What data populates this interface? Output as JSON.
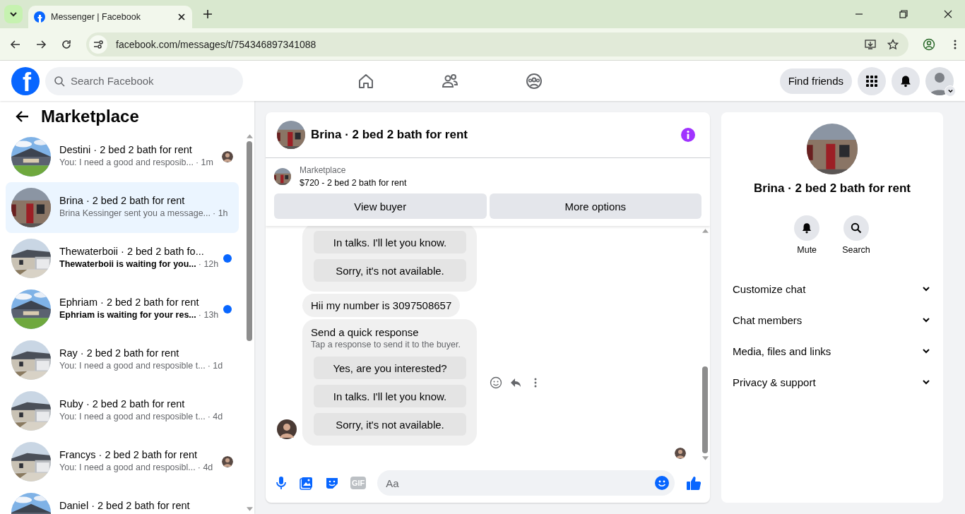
{
  "browser": {
    "tab_title": "Messenger | Facebook",
    "url": "facebook.com/messages/t/754346897341088"
  },
  "topbar": {
    "logo": "f",
    "search_placeholder": "Search Facebook",
    "find_friends": "Find friends"
  },
  "sidebar": {
    "title": "Marketplace",
    "conversations": [
      {
        "name": "Destini · 2 bed 2 bath for rent",
        "preview": "You: I need a good and resposib...",
        "time": "· 1m",
        "unread": false,
        "seen": true,
        "selected": false
      },
      {
        "name": "Brina · 2 bed 2 bath for rent",
        "preview": "Brina Kessinger sent you a message...",
        "time": "· 1h",
        "unread": false,
        "seen": false,
        "selected": true
      },
      {
        "name": "Thewaterboii · 2 bed 2 bath fo...",
        "preview": "Thewaterboii is waiting for you...",
        "time": "· 12h",
        "unread": true,
        "seen": false,
        "selected": false
      },
      {
        "name": "Ephriam · 2 bed 2 bath for rent",
        "preview": "Ephriam is waiting for your res...",
        "time": "· 13h",
        "unread": true,
        "seen": false,
        "selected": false
      },
      {
        "name": "Ray · 2 bed 2 bath for rent",
        "preview": "You: I need a good and resposible t...",
        "time": "· 1d",
        "unread": false,
        "seen": false,
        "selected": false
      },
      {
        "name": "Ruby · 2 bed 2 bath for rent",
        "preview": "You: I need a good and resposible t...",
        "time": "· 4d",
        "unread": false,
        "seen": false,
        "selected": false
      },
      {
        "name": "Francys · 2 bed 2 bath for rent",
        "preview": "You: I need a good and resposibl...",
        "time": "· 4d",
        "unread": false,
        "seen": true,
        "selected": false
      },
      {
        "name": "Daniel · 2 bed 2 bath for rent",
        "selected": false
      }
    ]
  },
  "chat": {
    "title": "Brina · 2 bed 2 bath for rent",
    "listing": {
      "source": "Marketplace",
      "title": "$720 - 2 bed 2 bath for rent"
    },
    "actions": [
      "View buyer",
      "More options"
    ],
    "messages": [
      {
        "kind": "quick_response",
        "options": [
          "In talks. I'll let you know.",
          "Sorry, it's not available."
        ]
      },
      {
        "kind": "text",
        "text": "Hii my number is 3097508657"
      },
      {
        "kind": "quick_response",
        "title": "Send a quick response",
        "subtitle": "Tap a response to send it to the buyer.",
        "options": [
          "Yes, are you interested?",
          "In talks. I'll let you know.",
          "Sorry, it's not available."
        ]
      }
    ],
    "composer": {
      "gif_label": "GIF",
      "placeholder": "Aa"
    }
  },
  "details": {
    "name": "Brina · 2 bed 2 bath for rent",
    "actions": [
      {
        "kind": "mute",
        "label": "Mute"
      },
      {
        "kind": "search",
        "label": "Search"
      }
    ],
    "sections": [
      {
        "label": "Customize chat",
        "expanded": false
      },
      {
        "label": "Chat members",
        "expanded": false
      },
      {
        "label": "Media, files and links",
        "expanded": false
      },
      {
        "label": "Privacy & support",
        "expanded": false
      }
    ]
  }
}
